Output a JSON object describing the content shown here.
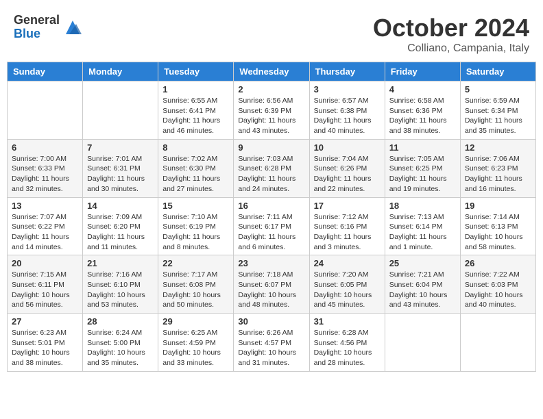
{
  "header": {
    "logo_general": "General",
    "logo_blue": "Blue",
    "month_title": "October 2024",
    "location": "Colliano, Campania, Italy"
  },
  "weekdays": [
    "Sunday",
    "Monday",
    "Tuesday",
    "Wednesday",
    "Thursday",
    "Friday",
    "Saturday"
  ],
  "weeks": [
    [
      {
        "day": "",
        "info": ""
      },
      {
        "day": "",
        "info": ""
      },
      {
        "day": "1",
        "info": "Sunrise: 6:55 AM\nSunset: 6:41 PM\nDaylight: 11 hours and 46 minutes."
      },
      {
        "day": "2",
        "info": "Sunrise: 6:56 AM\nSunset: 6:39 PM\nDaylight: 11 hours and 43 minutes."
      },
      {
        "day": "3",
        "info": "Sunrise: 6:57 AM\nSunset: 6:38 PM\nDaylight: 11 hours and 40 minutes."
      },
      {
        "day": "4",
        "info": "Sunrise: 6:58 AM\nSunset: 6:36 PM\nDaylight: 11 hours and 38 minutes."
      },
      {
        "day": "5",
        "info": "Sunrise: 6:59 AM\nSunset: 6:34 PM\nDaylight: 11 hours and 35 minutes."
      }
    ],
    [
      {
        "day": "6",
        "info": "Sunrise: 7:00 AM\nSunset: 6:33 PM\nDaylight: 11 hours and 32 minutes."
      },
      {
        "day": "7",
        "info": "Sunrise: 7:01 AM\nSunset: 6:31 PM\nDaylight: 11 hours and 30 minutes."
      },
      {
        "day": "8",
        "info": "Sunrise: 7:02 AM\nSunset: 6:30 PM\nDaylight: 11 hours and 27 minutes."
      },
      {
        "day": "9",
        "info": "Sunrise: 7:03 AM\nSunset: 6:28 PM\nDaylight: 11 hours and 24 minutes."
      },
      {
        "day": "10",
        "info": "Sunrise: 7:04 AM\nSunset: 6:26 PM\nDaylight: 11 hours and 22 minutes."
      },
      {
        "day": "11",
        "info": "Sunrise: 7:05 AM\nSunset: 6:25 PM\nDaylight: 11 hours and 19 minutes."
      },
      {
        "day": "12",
        "info": "Sunrise: 7:06 AM\nSunset: 6:23 PM\nDaylight: 11 hours and 16 minutes."
      }
    ],
    [
      {
        "day": "13",
        "info": "Sunrise: 7:07 AM\nSunset: 6:22 PM\nDaylight: 11 hours and 14 minutes."
      },
      {
        "day": "14",
        "info": "Sunrise: 7:09 AM\nSunset: 6:20 PM\nDaylight: 11 hours and 11 minutes."
      },
      {
        "day": "15",
        "info": "Sunrise: 7:10 AM\nSunset: 6:19 PM\nDaylight: 11 hours and 8 minutes."
      },
      {
        "day": "16",
        "info": "Sunrise: 7:11 AM\nSunset: 6:17 PM\nDaylight: 11 hours and 6 minutes."
      },
      {
        "day": "17",
        "info": "Sunrise: 7:12 AM\nSunset: 6:16 PM\nDaylight: 11 hours and 3 minutes."
      },
      {
        "day": "18",
        "info": "Sunrise: 7:13 AM\nSunset: 6:14 PM\nDaylight: 11 hours and 1 minute."
      },
      {
        "day": "19",
        "info": "Sunrise: 7:14 AM\nSunset: 6:13 PM\nDaylight: 10 hours and 58 minutes."
      }
    ],
    [
      {
        "day": "20",
        "info": "Sunrise: 7:15 AM\nSunset: 6:11 PM\nDaylight: 10 hours and 56 minutes."
      },
      {
        "day": "21",
        "info": "Sunrise: 7:16 AM\nSunset: 6:10 PM\nDaylight: 10 hours and 53 minutes."
      },
      {
        "day": "22",
        "info": "Sunrise: 7:17 AM\nSunset: 6:08 PM\nDaylight: 10 hours and 50 minutes."
      },
      {
        "day": "23",
        "info": "Sunrise: 7:18 AM\nSunset: 6:07 PM\nDaylight: 10 hours and 48 minutes."
      },
      {
        "day": "24",
        "info": "Sunrise: 7:20 AM\nSunset: 6:05 PM\nDaylight: 10 hours and 45 minutes."
      },
      {
        "day": "25",
        "info": "Sunrise: 7:21 AM\nSunset: 6:04 PM\nDaylight: 10 hours and 43 minutes."
      },
      {
        "day": "26",
        "info": "Sunrise: 7:22 AM\nSunset: 6:03 PM\nDaylight: 10 hours and 40 minutes."
      }
    ],
    [
      {
        "day": "27",
        "info": "Sunrise: 6:23 AM\nSunset: 5:01 PM\nDaylight: 10 hours and 38 minutes."
      },
      {
        "day": "28",
        "info": "Sunrise: 6:24 AM\nSunset: 5:00 PM\nDaylight: 10 hours and 35 minutes."
      },
      {
        "day": "29",
        "info": "Sunrise: 6:25 AM\nSunset: 4:59 PM\nDaylight: 10 hours and 33 minutes."
      },
      {
        "day": "30",
        "info": "Sunrise: 6:26 AM\nSunset: 4:57 PM\nDaylight: 10 hours and 31 minutes."
      },
      {
        "day": "31",
        "info": "Sunrise: 6:28 AM\nSunset: 4:56 PM\nDaylight: 10 hours and 28 minutes."
      },
      {
        "day": "",
        "info": ""
      },
      {
        "day": "",
        "info": ""
      }
    ]
  ]
}
